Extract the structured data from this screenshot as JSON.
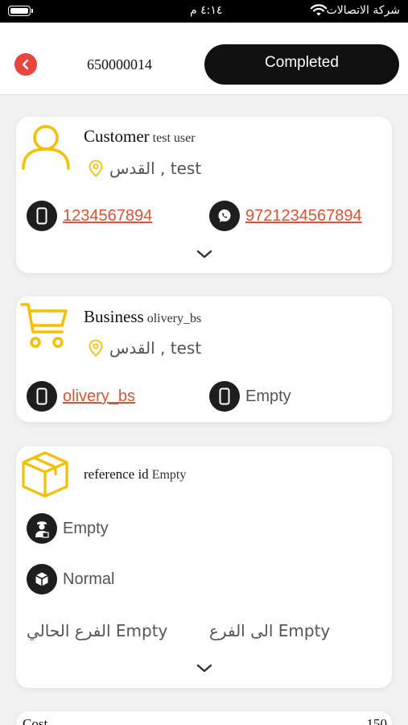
{
  "status_bar": {
    "carrier": "شركة الاتصالات",
    "time": "٤:١٤ م"
  },
  "header": {
    "order_number": "650000014",
    "status": "Completed"
  },
  "customer": {
    "label": "Customer",
    "name": "test user",
    "location": "القدس , test",
    "phone": "1234567894",
    "whatsapp": "9721234567894"
  },
  "business": {
    "label": "Business",
    "name": "olivery_bs",
    "location": "القدس , test",
    "contact": "olivery_bs",
    "phone": "Empty"
  },
  "order": {
    "reference_label": "reference id",
    "reference_value": "Empty",
    "driver": "Empty",
    "package_type": "Normal",
    "current_branch": "الفرع الحالي Empty",
    "to_branch": "الى الفرع Empty"
  },
  "cost": {
    "label": "Cost",
    "value": "150"
  },
  "colors": {
    "accent_yellow": "#f5c000",
    "link_orange": "#e0522f",
    "back_red": "#e8453c",
    "dark": "#1e1e1e"
  }
}
